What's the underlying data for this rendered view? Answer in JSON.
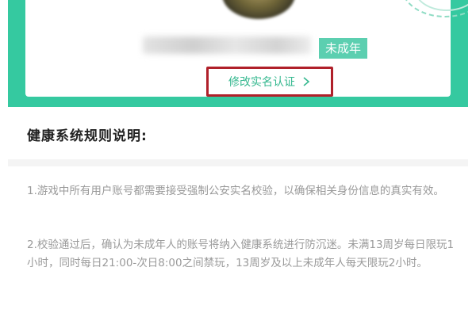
{
  "profile": {
    "status_badge": "未成年",
    "modify_button_label": "修改实名认证"
  },
  "rules": {
    "title": "健康系统规则说明:",
    "items": [
      "1.游戏中所有用户账号都需要接受强制公安实名校验，以确保相关身份信息的真实有效。",
      "2.校验通过后，确认为未成年人的账号将纳入健康系统进行防沉迷。未满13周岁每日限玩1小时，同时每日21:00-次日8:00之间禁玩，13周岁及以上未成年人每天限玩2小时。"
    ]
  },
  "colors": {
    "accent": "#35c9a0",
    "badge": "#5ccfb0",
    "highlight_box": "#b0202a"
  },
  "icons": {
    "modify_chevron": "chevron-right-icon"
  }
}
